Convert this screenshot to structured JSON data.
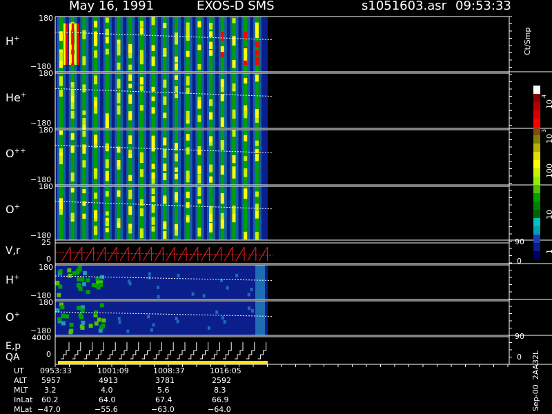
{
  "header": {
    "date": "May 16, 1991",
    "instrument": "EXOS-D SMS",
    "file": "s1051603.asr",
    "time": "09:53:33"
  },
  "panels": [
    {
      "label_main": "H",
      "label_sup": "+",
      "ytop": "180",
      "ybot": "−180"
    },
    {
      "label_main": "He",
      "label_sup": "+",
      "ytop": "180",
      "ybot": "−180"
    },
    {
      "label_main": "O",
      "label_sup": "++",
      "ytop": "180",
      "ybot": "−180"
    },
    {
      "label_main": "O",
      "label_sup": "+",
      "ytop": "180",
      "ybot": "−180"
    }
  ],
  "vr_panel": {
    "label": "V,r",
    "ytop": "25",
    "ybot": "0",
    "right_top": "90",
    "right_bot": "0"
  },
  "lower_panels": [
    {
      "label_main": "H",
      "label_sup": "+",
      "ytop": "180",
      "ybot": "−180"
    },
    {
      "label_main": "O",
      "label_sup": "+",
      "ytop": "180",
      "ybot": "−180"
    }
  ],
  "ep_panel": {
    "label1": "E,p",
    "label2": "QA",
    "ytop": "4000",
    "ybot": "0",
    "right_top": "90",
    "right_bot": "0"
  },
  "colorbar": {
    "unit": "Ct/Smp",
    "labels": [
      "10",
      "4",
      "10",
      "3",
      "100",
      "10",
      "1"
    ],
    "colors": [
      "#ffffff",
      "#8b0000",
      "#b40000",
      "#d80000",
      "#ff0000",
      "#8b4513",
      "#808000",
      "#b5b000",
      "#e0e000",
      "#ffff00",
      "#c8f000",
      "#90ee00",
      "#50c000",
      "#00a000",
      "#008000",
      "#006400",
      "#00c0c0",
      "#00a0b0",
      "#1e3cb4",
      "#0a1e8c",
      "#000064"
    ]
  },
  "ephemeris": {
    "rows": [
      {
        "name": "UT",
        "values": [
          "0953:33",
          "1001:09",
          "1008:37",
          "1016:05"
        ]
      },
      {
        "name": "ALT",
        "values": [
          "5957",
          "4913",
          "3781",
          "2592"
        ]
      },
      {
        "name": "MLT",
        "values": [
          "3.2",
          "4.0",
          "5.6",
          "8.3"
        ]
      },
      {
        "name": "InLat",
        "values": [
          "60.2",
          "64.0",
          "67.4",
          "66.9"
        ]
      },
      {
        "name": "MLat",
        "values": [
          "−47.0",
          "−55.6",
          "−63.0",
          "−64.0"
        ]
      }
    ]
  },
  "footer_vertical": "Sep-00  2AA32L",
  "chart_data": {
    "type": "heatmap",
    "title": "May 16, 1991   EXOS-D SMS",
    "xlabel": "UT",
    "x_tick_labels": [
      "0953:33",
      "1001:09",
      "1008:37",
      "1016:05"
    ],
    "panels": [
      {
        "name": "H+",
        "ylim": [
          -180,
          180
        ]
      },
      {
        "name": "He+",
        "ylim": [
          -180,
          180
        ]
      },
      {
        "name": "O++",
        "ylim": [
          -180,
          180
        ]
      },
      {
        "name": "O+",
        "ylim": [
          -180,
          180
        ]
      },
      {
        "name": "V,r",
        "ylim": [
          0,
          25
        ],
        "right_ylim": [
          0,
          90
        ]
      },
      {
        "name": "H+",
        "ylim": [
          -180,
          180
        ]
      },
      {
        "name": "O+",
        "ylim": [
          -180,
          180
        ]
      },
      {
        "name": "E,p",
        "ylim": [
          0,
          4000
        ],
        "right_ylim": [
          0,
          90
        ]
      }
    ],
    "colorbar_scale": "log",
    "colorbar_range": [
      1,
      10000
    ],
    "colorbar_label": "Ct/Smp"
  }
}
